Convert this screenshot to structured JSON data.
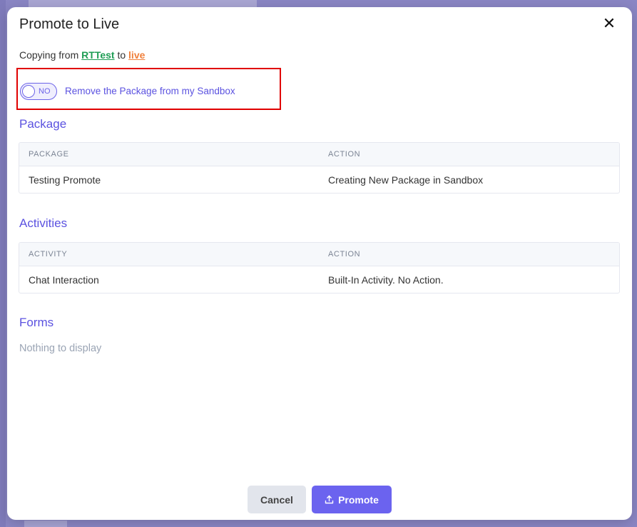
{
  "modal": {
    "title": "Promote to Live"
  },
  "copy": {
    "prefix": "Copying from ",
    "source": "RTTest",
    "middle": " to ",
    "target": "live"
  },
  "toggle": {
    "state_text": "NO",
    "label": "Remove the Package from my Sandbox"
  },
  "package": {
    "title": "Package",
    "columns": [
      "PACKAGE",
      "ACTION"
    ],
    "rows": [
      [
        "Testing Promote",
        "Creating New Package in Sandbox"
      ]
    ]
  },
  "activities": {
    "title": "Activities",
    "columns": [
      "ACTIVITY",
      "ACTION"
    ],
    "rows": [
      [
        "Chat Interaction",
        "Built-In Activity. No Action."
      ]
    ]
  },
  "forms": {
    "title": "Forms",
    "empty_text": "Nothing to display"
  },
  "buttons": {
    "cancel": "Cancel",
    "promote": "Promote"
  },
  "icons": {
    "close": "close-icon",
    "promote": "upload-icon"
  },
  "colors": {
    "accent": "#6b63ef",
    "source_link": "#1f9d55",
    "target_link": "#f0803c",
    "highlight": "#e00000"
  }
}
